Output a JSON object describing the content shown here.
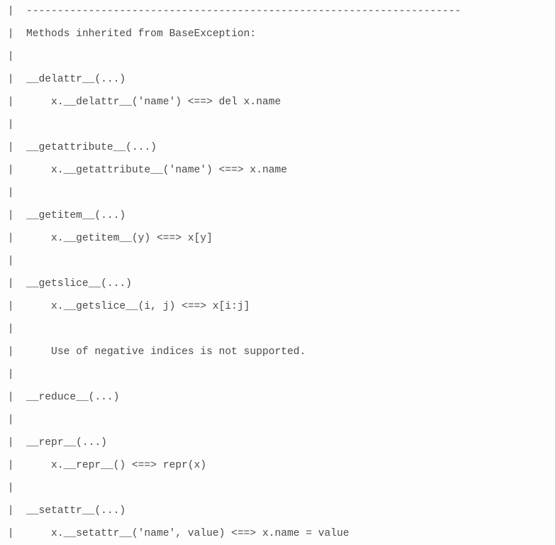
{
  "lines": [
    " |  ----------------------------------------------------------------------",
    " |  Methods inherited from BaseException:",
    " |",
    " |  __delattr__(...)",
    " |      x.__delattr__('name') <==> del x.name",
    " |",
    " |  __getattribute__(...)",
    " |      x.__getattribute__('name') <==> x.name",
    " |",
    " |  __getitem__(...)",
    " |      x.__getitem__(y) <==> x[y]",
    " |",
    " |  __getslice__(...)",
    " |      x.__getslice__(i, j) <==> x[i:j]",
    " |",
    " |      Use of negative indices is not supported.",
    " |",
    " |  __reduce__(...)",
    " |",
    " |  __repr__(...)",
    " |      x.__repr__() <==> repr(x)",
    " |",
    " |  __setattr__(...)",
    " |      x.__setattr__('name', value) <==> x.name = value"
  ]
}
